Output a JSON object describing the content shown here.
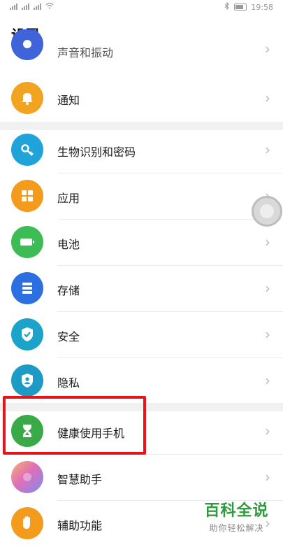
{
  "status_bar": {
    "time": "19:58"
  },
  "page": {
    "title": "设置"
  },
  "settings": {
    "sound": {
      "label": "声音和振动",
      "color": "#3f63d8"
    },
    "notifications": {
      "label": "通知",
      "color": "#f3a322"
    },
    "biometrics": {
      "label": "生物识别和密码",
      "color": "#1fa3d8"
    },
    "apps": {
      "label": "应用",
      "color": "#f39b1c"
    },
    "battery": {
      "label": "电池",
      "color": "#3dbb55"
    },
    "storage": {
      "label": "存储",
      "color": "#2b6fe0"
    },
    "security": {
      "label": "安全",
      "color": "#1ca3c9"
    },
    "privacy": {
      "label": "隐私",
      "color": "#1d9bc4"
    },
    "digital_balance": {
      "label": "健康使用手机",
      "color": "#3aaa49"
    },
    "assistant": {
      "label": "智慧助手",
      "color": "#e06fb7"
    },
    "accessibility": {
      "label": "辅助功能",
      "color": "#f39b1c"
    }
  },
  "chevron": "›",
  "watermark": {
    "title": "百科全说",
    "subtitle": "助你轻松解决"
  }
}
